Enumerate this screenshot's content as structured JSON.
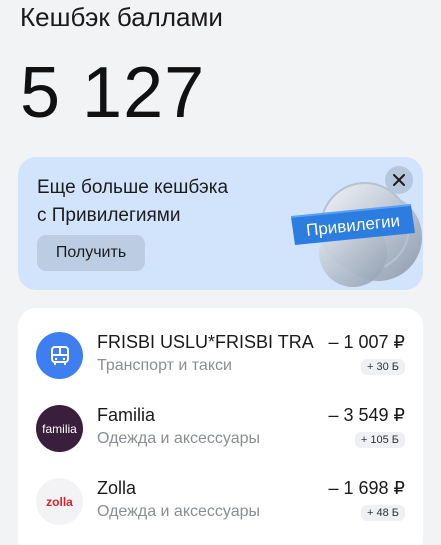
{
  "header": {
    "title": "Кешбэк баллами",
    "amount": "5 127"
  },
  "promo": {
    "line1": "Еще больше кешбэка",
    "line2": "с Привилегиями",
    "button_label": "Получить",
    "badge_label": "Привилегии",
    "close_icon": "close-icon"
  },
  "transactions": [
    {
      "name": "FRISBI USLU*FRISBI TRA",
      "category": "Транспорт и такси",
      "amount": "– 1 007 ₽",
      "bonus": "+ 30 Б",
      "icon": "bus-icon",
      "icon_bg": "#3e7ef0"
    },
    {
      "name": "Familia",
      "category": "Одежда и аксессуары",
      "amount": "– 3 549 ₽",
      "bonus": "+ 105 Б",
      "logo_text": "familia",
      "icon_bg": "#3a1f3d"
    },
    {
      "name": "Zolla",
      "category": "Одежда и аксессуары",
      "amount": "– 1 698 ₽",
      "bonus": "+ 48 Б",
      "logo_text": "zolla",
      "icon_bg": "#f3f3f5",
      "logo_color": "#e0212b"
    }
  ]
}
